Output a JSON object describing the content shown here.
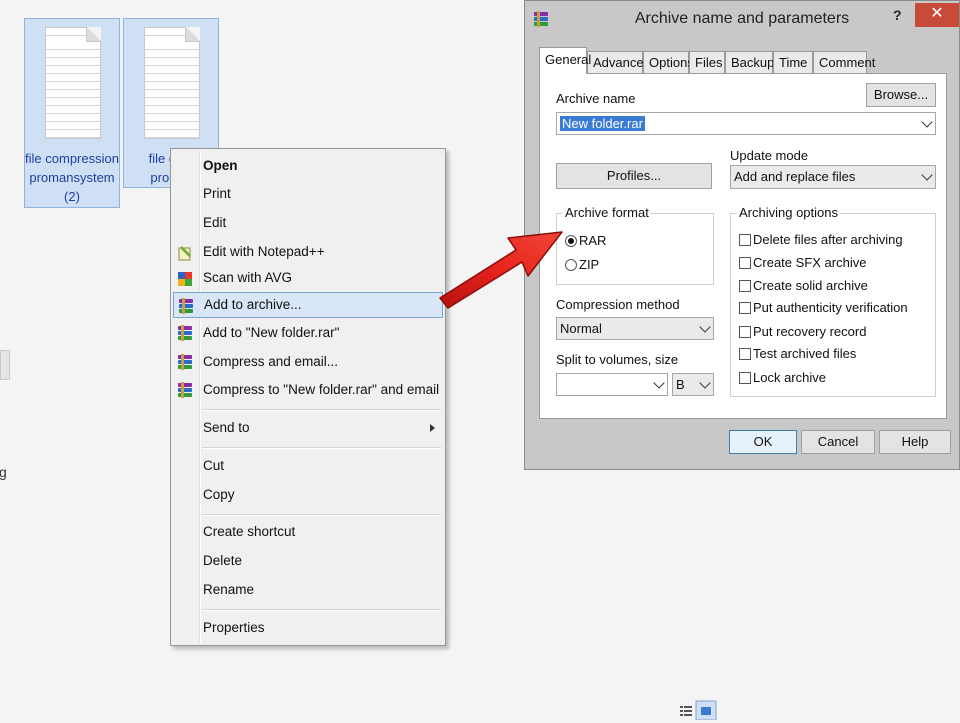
{
  "desktop": {
    "files": [
      {
        "label_lines": [
          "file compression",
          "promansystem",
          "(2)"
        ]
      },
      {
        "label_lines": [
          "file com",
          "promar"
        ]
      }
    ],
    "left_edge_glyph": "g"
  },
  "context_menu": {
    "items": [
      {
        "label": "Open",
        "bold": true
      },
      {
        "label": "Print"
      },
      {
        "label": "Edit"
      },
      {
        "label": "Edit with Notepad++",
        "icon": "notepad-plus-icon"
      },
      {
        "label": "Scan with AVG",
        "icon": "avg-icon"
      },
      {
        "label": "Add to archive...",
        "icon": "winrar-icon",
        "highlighted": true
      },
      {
        "label": "Add to \"New folder.rar\"",
        "icon": "winrar-icon"
      },
      {
        "label": "Compress and email...",
        "icon": "winrar-icon"
      },
      {
        "label": "Compress to \"New folder.rar\" and email",
        "icon": "winrar-icon"
      },
      {
        "label": "Send to",
        "submenu": true
      },
      {
        "label": "Cut"
      },
      {
        "label": "Copy"
      },
      {
        "label": "Create shortcut"
      },
      {
        "label": "Delete"
      },
      {
        "label": "Rename"
      },
      {
        "label": "Properties"
      }
    ]
  },
  "dialog": {
    "title": "Archive name and parameters",
    "help_glyph": "?",
    "close_glyph": "✕",
    "tabs": [
      "General",
      "Advanced",
      "Options",
      "Files",
      "Backup",
      "Time",
      "Comment"
    ],
    "active_tab": "General",
    "archive_name_label": "Archive name",
    "archive_name_value": "New folder.rar",
    "browse_label": "Browse...",
    "profiles_label": "Profiles...",
    "update_mode_label": "Update mode",
    "update_mode_value": "Add and replace files",
    "archive_format_label": "Archive format",
    "formats": [
      {
        "label": "RAR",
        "selected": true
      },
      {
        "label": "ZIP",
        "selected": false
      }
    ],
    "compression_method_label": "Compression method",
    "compression_method_value": "Normal",
    "split_label": "Split to volumes, size",
    "split_value": "",
    "split_unit": "B",
    "archiving_options_label": "Archiving options",
    "options": [
      {
        "label": "Delete files after archiving",
        "checked": false
      },
      {
        "label": "Create SFX archive",
        "checked": false
      },
      {
        "label": "Create solid archive",
        "checked": false
      },
      {
        "label": "Put authenticity verification",
        "checked": false
      },
      {
        "label": "Put recovery record",
        "checked": false
      },
      {
        "label": "Test archived files",
        "checked": false
      },
      {
        "label": "Lock archive",
        "checked": false
      }
    ],
    "ok_label": "OK",
    "cancel_label": "Cancel",
    "help_label": "Help"
  },
  "colors": {
    "highlight_bg": "#d8e6f7",
    "arrow_red": "#e0201a",
    "close_red": "#c84b3a",
    "selection_blue": "#3a7bd5",
    "file_label_blue": "#1c3fa0"
  }
}
